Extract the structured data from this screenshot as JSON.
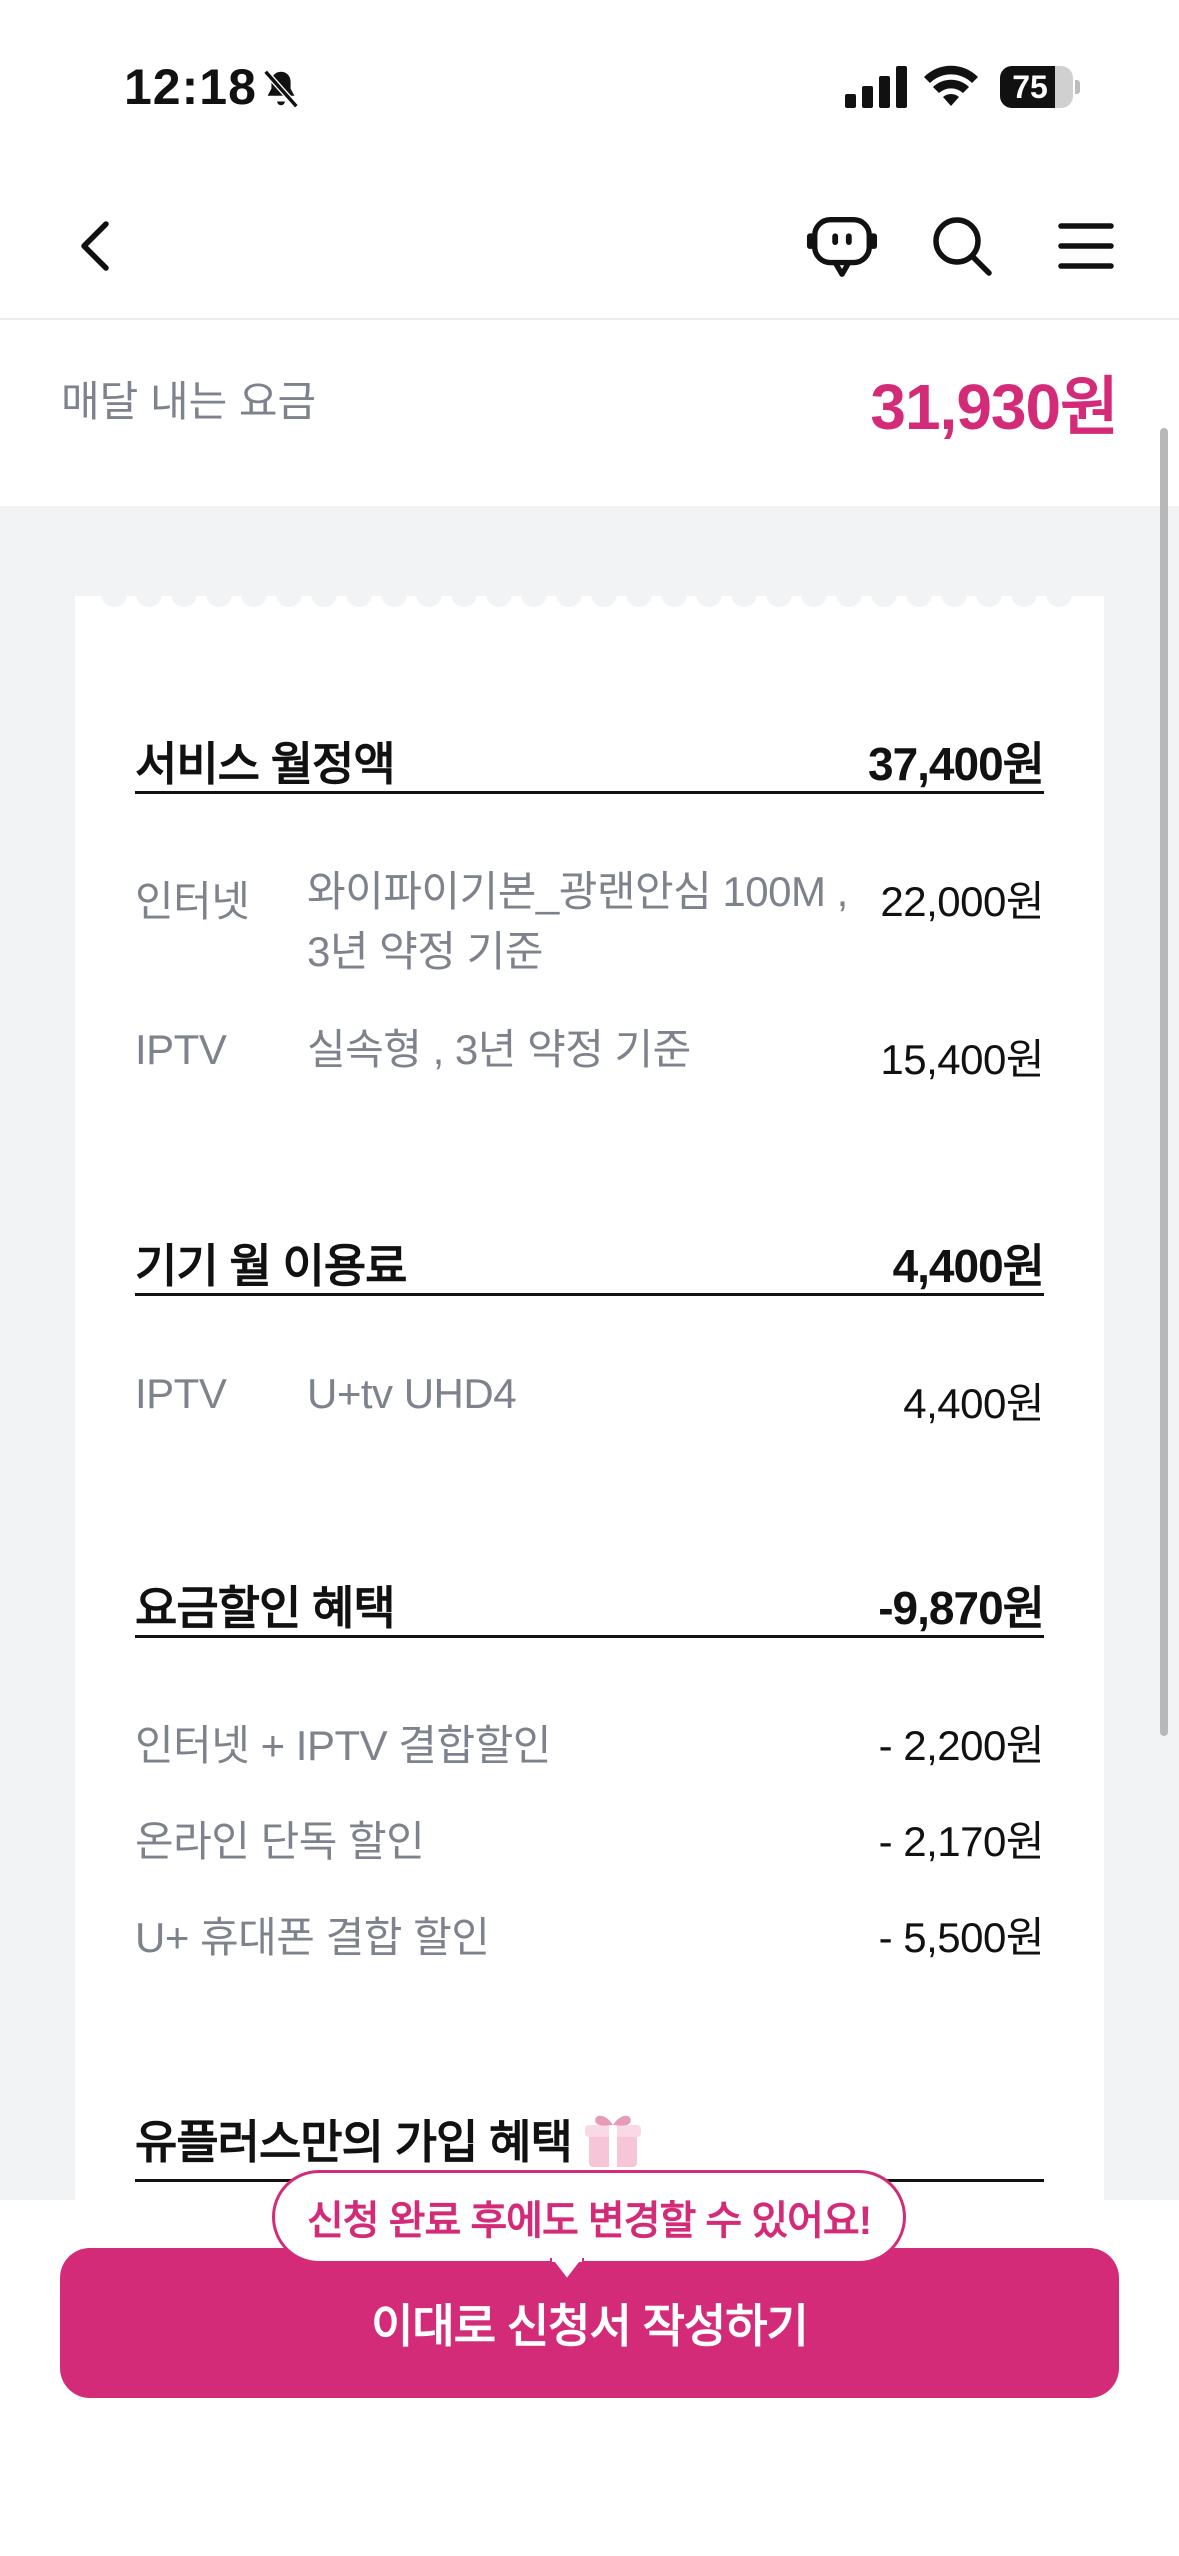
{
  "status": {
    "time": "12:18",
    "battery": "75",
    "battery_level": 0.75
  },
  "nav": {
    "icons": [
      "back-icon",
      "chatbot-icon",
      "search-icon",
      "menu-icon"
    ]
  },
  "fee": {
    "label": "매달 내는 요금",
    "value": "31,930원"
  },
  "sections": {
    "service": {
      "title": "서비스 월정액",
      "amount": "37,400원",
      "rows": [
        {
          "category": "인터넷",
          "desc_line1": "와이파이기본_광랜안심 100M ,",
          "desc_line2": "3년 약정 기준",
          "price": "22,000원"
        },
        {
          "category": "IPTV",
          "desc_line1": "실속형 , 3년 약정 기준",
          "price": "15,400원"
        }
      ]
    },
    "device": {
      "title": "기기 월 이용료",
      "amount": "4,400원",
      "rows": [
        {
          "category": "IPTV",
          "desc_line1": "U+tv UHD4",
          "price": "4,400원"
        }
      ]
    },
    "discount": {
      "title": "요금할인 혜택",
      "amount": "-9,870원",
      "rows": [
        {
          "label": "인터넷 + IPTV 결합할인",
          "price": "- 2,200원"
        },
        {
          "label": "온라인 단독 할인",
          "price": "- 2,170원"
        },
        {
          "label": "U+ 휴대폰 결합 할인",
          "price": "- 5,500원"
        }
      ]
    },
    "benefit": {
      "title": "유플러스만의 가입 혜택"
    }
  },
  "cta": {
    "tooltip": "신청 완료 후에도 변경할 수 있어요!",
    "label": "이대로 신청서 작성하기"
  },
  "colors": {
    "accent": "#d42b78",
    "muted_text": "#7d828c",
    "background_gray": "#f2f3f5"
  }
}
